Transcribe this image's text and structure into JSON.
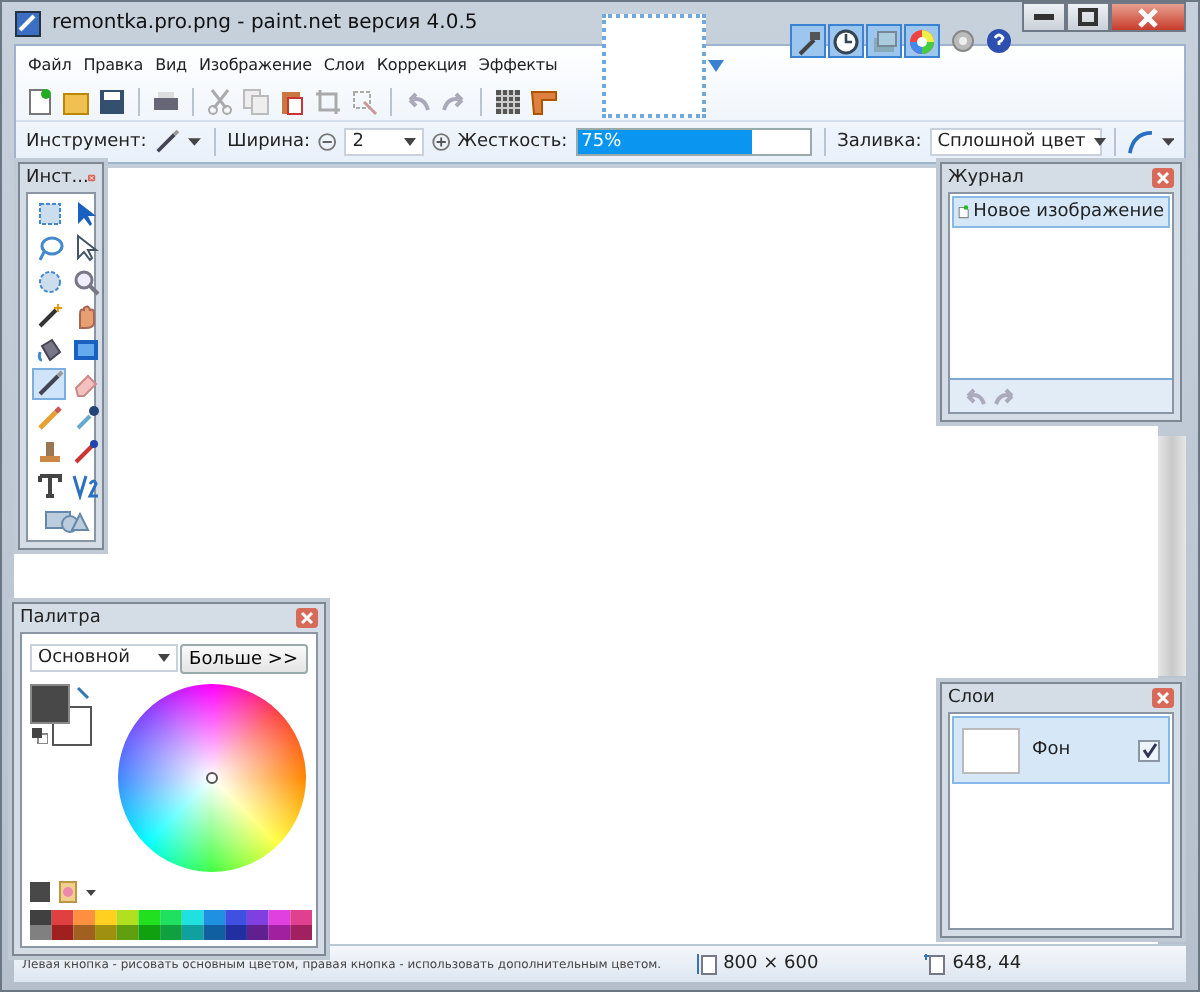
{
  "window": {
    "title": "remontka.pro.png - paint.net версия 4.0.5"
  },
  "panel_toggles": [
    {
      "on": true
    },
    {
      "on": true
    },
    {
      "on": true
    },
    {
      "on": true
    }
  ],
  "menu": [
    "Файл",
    "Правка",
    "Вид",
    "Изображение",
    "Слои",
    "Коррекция",
    "Эффекты"
  ],
  "tool_options": {
    "tool_label": "Инструмент:",
    "width_label": "Ширина:",
    "width_value": "2",
    "hardness_label": "Жесткость:",
    "hardness": {
      "level": 0.75,
      "reading": "75%"
    },
    "fill_label": "Заливка:",
    "fill_value": "Сплошной цвет"
  },
  "tools_panel": {
    "title": "Инст...",
    "tools": [
      {
        "selected": false
      },
      {
        "selected": false
      },
      {
        "selected": false
      },
      {
        "selected": false
      },
      {
        "selected": false
      },
      {
        "selected": false
      },
      {
        "selected": false
      },
      {
        "selected": false
      },
      {
        "selected": false
      },
      {
        "selected": false
      },
      {
        "selected": true
      },
      {
        "selected": false
      },
      {
        "selected": false
      },
      {
        "selected": false
      },
      {
        "selected": false
      },
      {
        "selected": false
      },
      {
        "selected": false
      },
      {
        "selected": false
      },
      {
        "selected": false
      }
    ]
  },
  "history_panel": {
    "title": "Журнал",
    "items": [
      {
        "label": "Новое изображение",
        "selected": true
      }
    ]
  },
  "palette_panel": {
    "title": "Палитра",
    "mode": "Основной",
    "more_button": "Больше >>"
  },
  "layers_panel": {
    "title": "Слои",
    "layers": [
      {
        "name": "Фон",
        "selected": true,
        "visible": true
      }
    ]
  },
  "status_bar": {
    "hint": "Левая кнопка - рисовать основным цветом, правая кнопка - использовать дополнительным цветом.",
    "image_size": "800 × 600",
    "cursor": "648, 44"
  }
}
